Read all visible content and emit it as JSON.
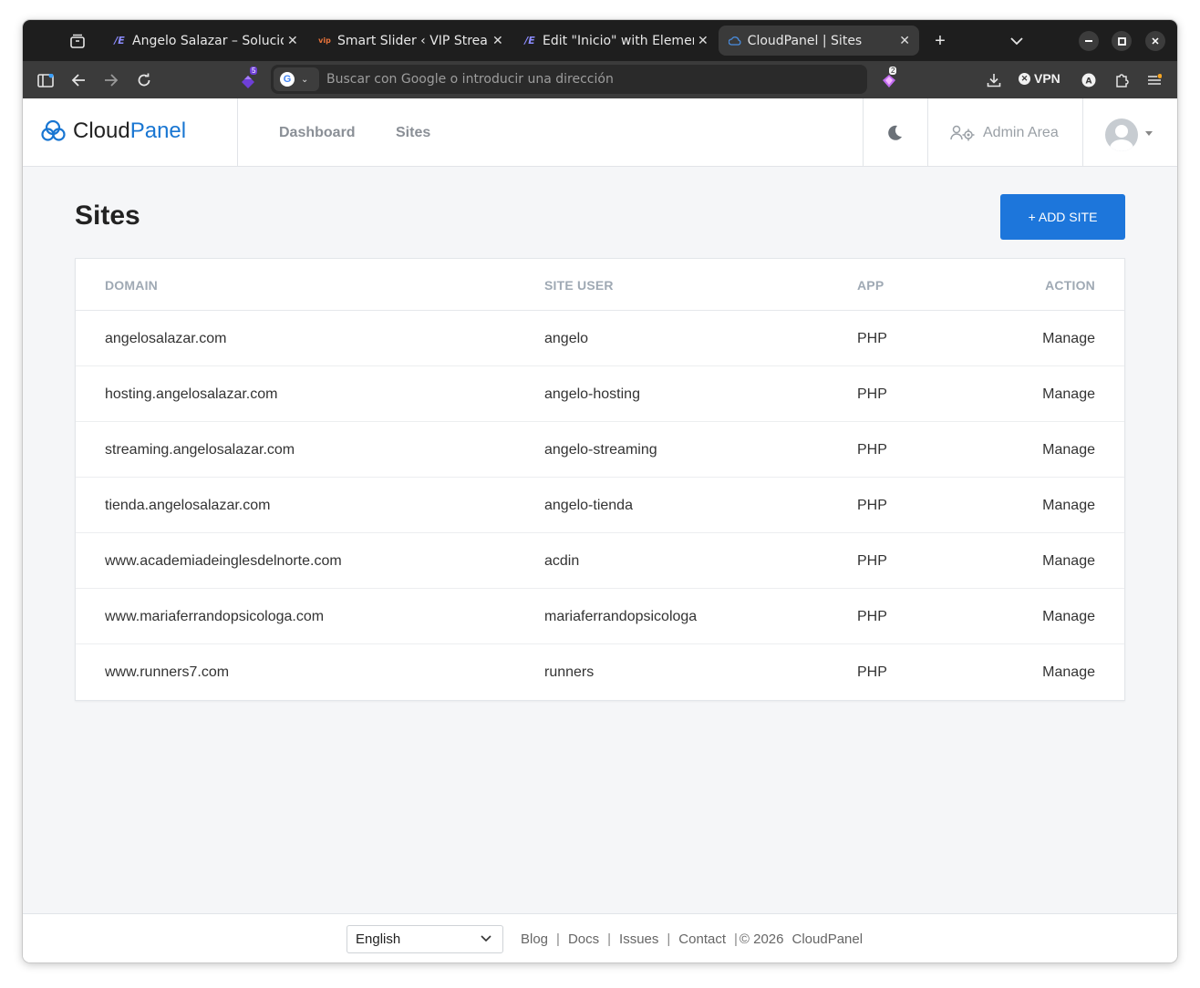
{
  "browser": {
    "tabs": [
      {
        "label": "Angelo Salazar – Soluciones",
        "favicon": "elementor-icon",
        "active": false
      },
      {
        "label": "Smart Slider ‹ VIP Streaming",
        "favicon": "vip-icon",
        "active": false
      },
      {
        "label": "Edit \"Inicio\" with Elementor",
        "favicon": "elementor-icon",
        "active": false
      },
      {
        "label": "CloudPanel | Sites",
        "favicon": "cloud-icon",
        "active": true
      }
    ],
    "new_tab": "+",
    "url_placeholder": "Buscar con Google o introducir una dirección",
    "vpn_label": "VPN",
    "badges": {
      "extension": "5",
      "wallet": "2"
    },
    "colors": {
      "tabbar": "#1e1e1e",
      "toolbar": "#3b3b3b"
    }
  },
  "app": {
    "logo": {
      "part1": "Cloud",
      "part2": "Panel"
    },
    "nav": {
      "dashboard": "Dashboard",
      "sites": "Sites"
    },
    "admin_area": "Admin Area",
    "accent_color": "#1d76db"
  },
  "page": {
    "title": "Sites",
    "add_button": "+ ADD SITE"
  },
  "table": {
    "headers": {
      "domain": "DOMAIN",
      "site_user": "SITE USER",
      "app": "APP",
      "action": "ACTION"
    },
    "rows": [
      {
        "domain": "angelosalazar.com",
        "site_user": "angelo",
        "app": "PHP",
        "action": "Manage"
      },
      {
        "domain": "hosting.angelosalazar.com",
        "site_user": "angelo-hosting",
        "app": "PHP",
        "action": "Manage"
      },
      {
        "domain": "streaming.angelosalazar.com",
        "site_user": "angelo-streaming",
        "app": "PHP",
        "action": "Manage"
      },
      {
        "domain": "tienda.angelosalazar.com",
        "site_user": "angelo-tienda",
        "app": "PHP",
        "action": "Manage"
      },
      {
        "domain": "www.academiadeinglesdelnorte.com",
        "site_user": "acdin",
        "app": "PHP",
        "action": "Manage"
      },
      {
        "domain": "www.mariaferrandopsicologa.com",
        "site_user": "mariaferrandopsicologa",
        "app": "PHP",
        "action": "Manage"
      },
      {
        "domain": "www.runners7.com",
        "site_user": "runners",
        "app": "PHP",
        "action": "Manage"
      }
    ]
  },
  "footer": {
    "language": "English",
    "links": {
      "blog": "Blog",
      "docs": "Docs",
      "issues": "Issues",
      "contact": "Contact"
    },
    "copyright": "© 2026",
    "brand": "CloudPanel"
  }
}
